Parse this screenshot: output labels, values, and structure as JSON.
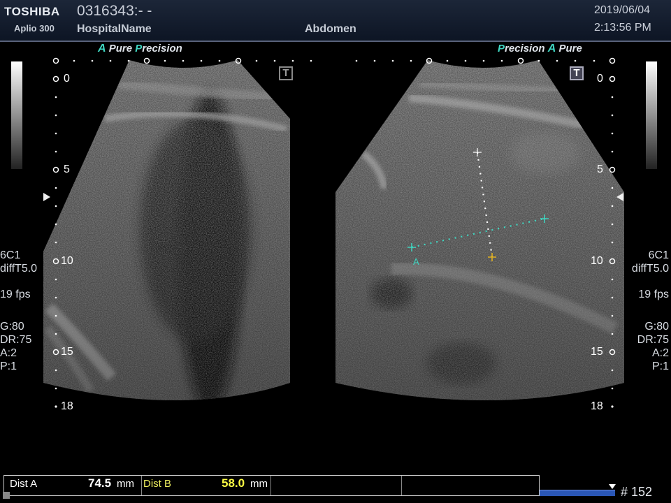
{
  "header": {
    "brand": "TOSHIBA",
    "model": "Aplio 300",
    "patient_id": "0316343:- -",
    "hospital": "HospitalName",
    "exam": "Abdomen",
    "date": "2019/06/04",
    "time": "2:13:56 PM"
  },
  "left_panel": {
    "mode_a": "A",
    "mode_pure": "Pure",
    "mode_p": "P",
    "mode_precision": "recision",
    "t_icon": "T"
  },
  "right_panel": {
    "mode_p": "P",
    "mode_precision": "recision",
    "mode_a": "A",
    "mode_pure": "Pure",
    "t_icon": "T"
  },
  "depth_labels": [
    "0",
    "5",
    "10",
    "15",
    "18"
  ],
  "side_info": {
    "probe": "6C1",
    "preset": "diffT5.0",
    "fps": "19 fps",
    "gain": "G:80",
    "dynamic_range": "DR:75",
    "a_setting": "A:2",
    "p_setting": "P:1"
  },
  "caliper": {
    "label": "A"
  },
  "measurements": {
    "dist_a_label": "Dist A",
    "dist_a_value": "74.5",
    "dist_a_unit": "mm",
    "dist_b_label": "Dist B",
    "dist_b_value": "58.0",
    "dist_b_unit": "mm"
  },
  "cine": {
    "frame": "# 152"
  },
  "colors": {
    "accent": "#3fd7c2",
    "dist_b_value": "#ffff44",
    "header_bg": "#131c2c"
  }
}
